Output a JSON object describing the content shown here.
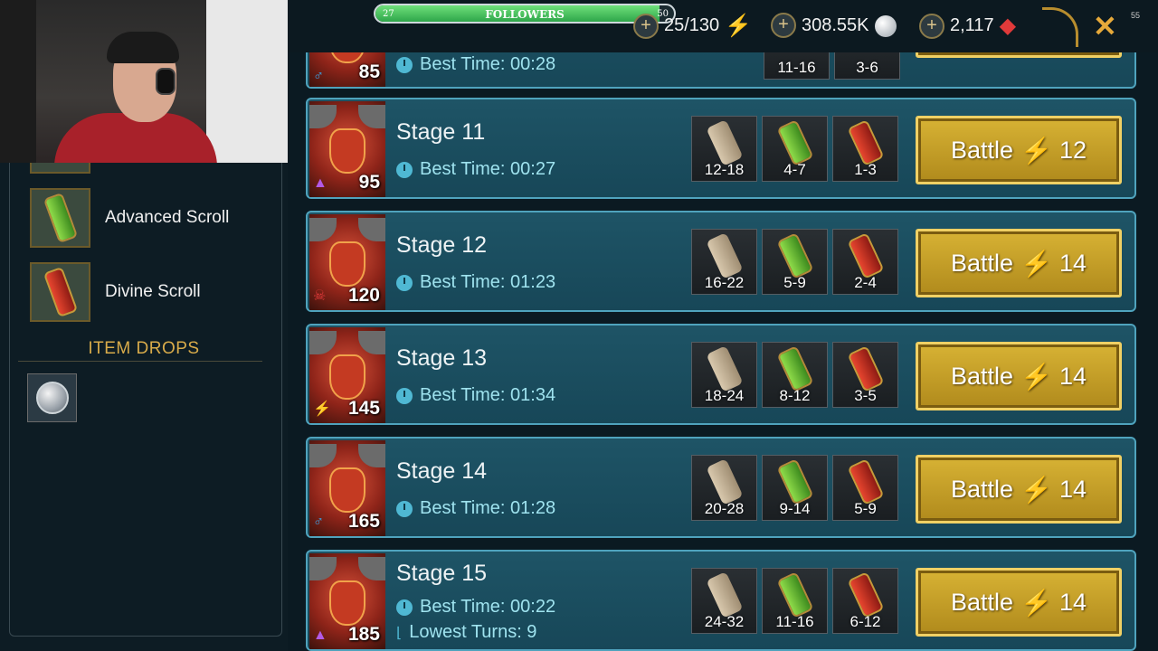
{
  "followers": {
    "label": "FOLLOWERS",
    "min": "27",
    "max": "50",
    "progress": 0.95
  },
  "resources": {
    "energy": {
      "value": "25/130",
      "icon": "lightning-bolt-icon"
    },
    "silver": {
      "value": "308.55K",
      "icon": "silver-coin-icon"
    },
    "gems": {
      "value": "2,117",
      "icon": "ruby-gem-icon"
    }
  },
  "corner_number": "55",
  "left_panel": {
    "scrolls": [
      {
        "name": "Advanced Scroll",
        "type": "adv"
      },
      {
        "name": "Divine Scroll",
        "type": "div"
      }
    ],
    "item_drops_title": "ITEM DROPS"
  },
  "partial_stage": {
    "level": "85",
    "best_time": "Best Time: 00:28",
    "rewards": [
      "11-16",
      "3-6"
    ]
  },
  "stages": [
    {
      "name": "Stage 11",
      "best_time": "Best Time: 00:27",
      "level": "95",
      "affinity": "▲",
      "affinity_color": "#b35ae6",
      "rewards": [
        "12-18",
        "4-7",
        "1-3"
      ],
      "battle_label": "Battle",
      "energy_cost": "12"
    },
    {
      "name": "Stage 12",
      "best_time": "Best Time: 01:23",
      "level": "120",
      "affinity": "☠",
      "affinity_color": "#e03a3a",
      "rewards": [
        "16-22",
        "5-9",
        "2-4"
      ],
      "battle_label": "Battle",
      "energy_cost": "14"
    },
    {
      "name": "Stage 13",
      "best_time": "Best Time: 01:34",
      "level": "145",
      "affinity": "⚡",
      "affinity_color": "#6fe03a",
      "rewards": [
        "18-24",
        "8-12",
        "3-5"
      ],
      "battle_label": "Battle",
      "energy_cost": "14"
    },
    {
      "name": "Stage 14",
      "best_time": "Best Time: 01:28",
      "level": "165",
      "affinity": "♂",
      "affinity_color": "#3aa3e6",
      "rewards": [
        "20-28",
        "9-14",
        "5-9"
      ],
      "battle_label": "Battle",
      "energy_cost": "14"
    },
    {
      "name": "Stage 15",
      "best_time": "Best Time: 00:22",
      "lowest_turns": "Lowest Turns: 9",
      "level": "185",
      "affinity": "▲",
      "affinity_color": "#b35ae6",
      "rewards": [
        "24-32",
        "11-16",
        "6-12"
      ],
      "battle_label": "Battle",
      "energy_cost": "14"
    }
  ]
}
